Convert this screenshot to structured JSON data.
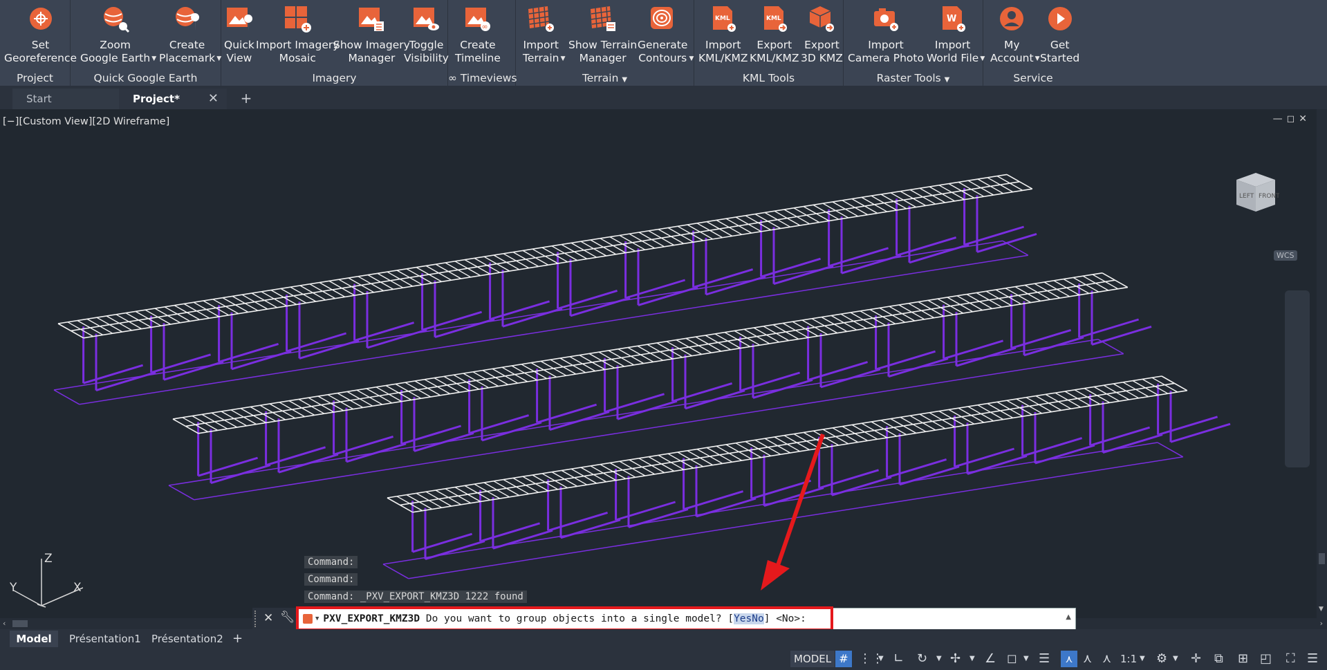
{
  "ribbon": {
    "groups": [
      {
        "label": "Project",
        "buttons": [
          {
            "label": "Set\nGeoreference",
            "icon": "georeference-icon"
          }
        ]
      },
      {
        "label": "Quick Google Earth",
        "buttons": [
          {
            "label": "Zoom\nGoogle Earth",
            "icon": "zoom-google-earth-icon"
          },
          {
            "label": "Create\nPlacemark",
            "icon": "create-placemark-icon"
          }
        ]
      },
      {
        "label": "Imagery",
        "buttons": [
          {
            "label": "Quick\nView",
            "icon": "quick-view-icon"
          },
          {
            "label": "Import Imagery\nMosaic",
            "icon": "import-imagery-mosaic-icon"
          },
          {
            "label": "Show Imagery\nManager",
            "icon": "imagery-manager-icon"
          },
          {
            "label": "Toggle\nVisibility",
            "icon": "toggle-visibility-icon"
          }
        ]
      },
      {
        "label": "∞ Timeviews",
        "buttons": [
          {
            "label": "Create\nTimeline",
            "icon": "create-timeline-icon"
          }
        ]
      },
      {
        "label": "Terrain",
        "buttons": [
          {
            "label": "Import\nTerrain",
            "icon": "import-terrain-icon"
          },
          {
            "label": "Show Terrain\nManager",
            "icon": "terrain-manager-icon"
          },
          {
            "label": "Generate\nContours",
            "icon": "generate-contours-icon"
          }
        ]
      },
      {
        "label": "KML Tools",
        "buttons": [
          {
            "label": "Import\nKML/KMZ",
            "icon": "import-kml-icon"
          },
          {
            "label": "Export\nKML/KMZ",
            "icon": "export-kml-icon"
          },
          {
            "label": "Export\n3D KMZ",
            "icon": "export-3d-kmz-icon"
          }
        ]
      },
      {
        "label": "Raster Tools",
        "buttons": [
          {
            "label": "Import\nCamera Photo",
            "icon": "import-camera-photo-icon"
          },
          {
            "label": "Import\nWorld File",
            "icon": "import-world-file-icon"
          }
        ]
      },
      {
        "label": "Service",
        "buttons": [
          {
            "label": "My\nAccount",
            "icon": "account-icon"
          },
          {
            "label": "Get\nStarted",
            "icon": "get-started-icon"
          }
        ]
      }
    ]
  },
  "tabs": {
    "start": "Start",
    "project": "Project*"
  },
  "viewport": {
    "label": "[−][Custom View][2D Wireframe]",
    "axis_x": "X",
    "axis_y": "Y",
    "axis_z": "Z",
    "cube_left": "LEFT",
    "cube_front": "FRONT",
    "wcs": "WCS"
  },
  "command": {
    "history": [
      "Command:",
      "Command:",
      "Command: _PXV_EXPORT_KMZ3D 1222 found"
    ],
    "name": "PXV_EXPORT_KMZ3D",
    "prompt": " Do you want to group objects into a single model? [",
    "opt_yes": "Yes",
    "opt_no": "No",
    "suffix": "] <No>:"
  },
  "layouts": [
    "Model",
    "Présentation1",
    "Présentation2"
  ],
  "status": {
    "model": "MODEL",
    "scale": "1:1"
  },
  "colors": {
    "accent": "#e8643a",
    "wire": "#7a2ee0",
    "highlight": "#e5191c"
  }
}
